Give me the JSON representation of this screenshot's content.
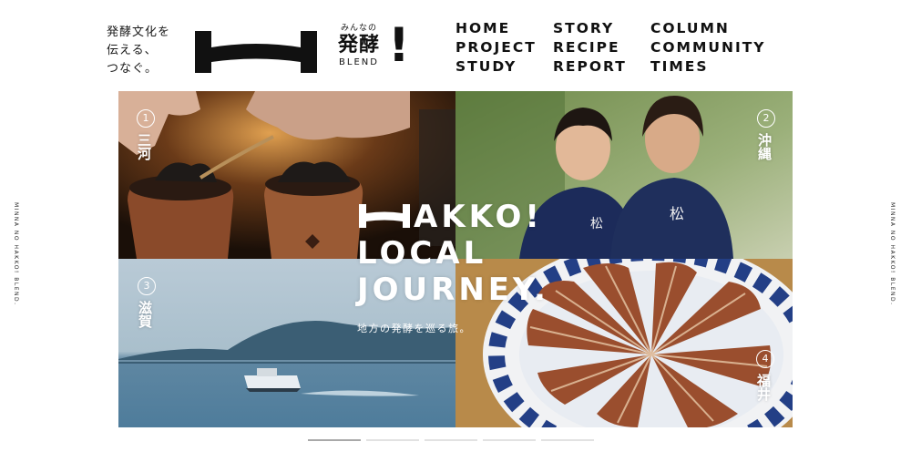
{
  "header": {
    "tagline": [
      "発酵文化を",
      "伝える、",
      "つなぐ。"
    ],
    "logo": {
      "line1": "みんなの",
      "line2": "発酵",
      "line3": "BLEND",
      "exclaim": "!"
    }
  },
  "nav": {
    "items": [
      "HOME",
      "STORY",
      "COLUMN",
      "PROJECT",
      "RECIPE",
      "COMMUNITY",
      "STUDY",
      "REPORT",
      "TIMES"
    ]
  },
  "side_text": "MINNA NO HAKKO! BLEND.",
  "hero": {
    "headline_lines": [
      "AKKO!",
      "LOCAL",
      "JOURNEY."
    ],
    "subtitle": "地方の発酵を巡る旅。",
    "regions": [
      {
        "num": "1",
        "name": "三河"
      },
      {
        "num": "2",
        "name": "沖縄"
      },
      {
        "num": "3",
        "name": "滋賀"
      },
      {
        "num": "4",
        "name": "福井"
      }
    ]
  },
  "slider": {
    "count": 5,
    "active": 1
  },
  "colors": {
    "text": "#111111",
    "accent": "#1f2f5c",
    "background": "#ffffff"
  }
}
